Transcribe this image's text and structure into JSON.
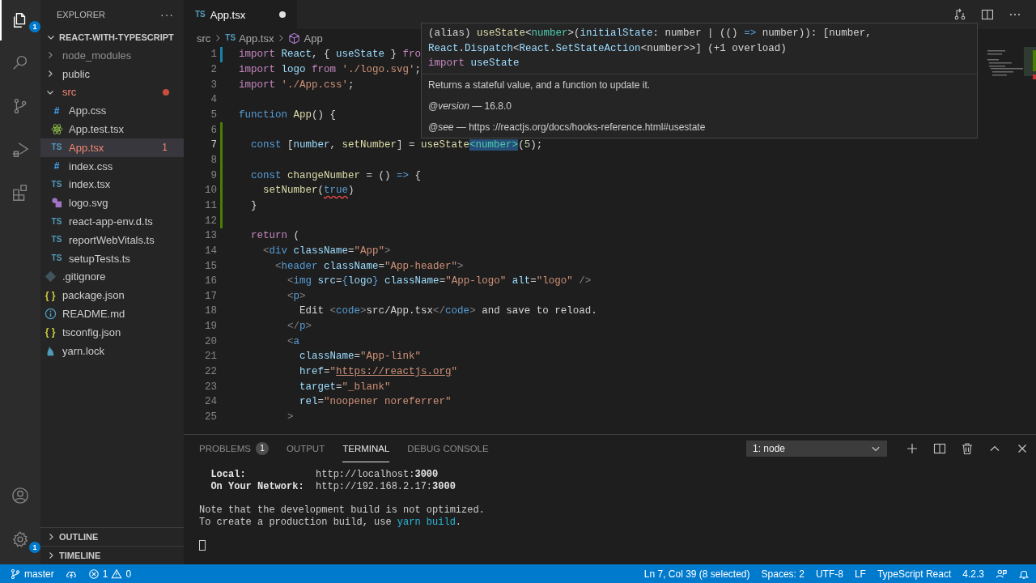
{
  "activity_bar": {
    "items": [
      {
        "kind": "explorer",
        "selected": true,
        "badge": "1"
      },
      {
        "kind": "search",
        "selected": false
      },
      {
        "kind": "source-control",
        "selected": false
      },
      {
        "kind": "run-debug",
        "selected": false
      },
      {
        "kind": "extensions",
        "selected": false
      }
    ],
    "bottom_items": [
      {
        "kind": "account"
      },
      {
        "kind": "settings",
        "badge": "1"
      }
    ]
  },
  "sidebar": {
    "title": "EXPLORER",
    "more": "···",
    "root": {
      "label": "REACT-WITH-TYPESCRIPT",
      "expanded": true,
      "children": [
        {
          "label": "node_modules",
          "kind": "folder",
          "expanded": false,
          "selected": false,
          "error": false,
          "ignored": true
        },
        {
          "label": "public",
          "kind": "folder",
          "expanded": false,
          "selected": false,
          "error": false,
          "ignored": false
        },
        {
          "label": "src",
          "kind": "folder",
          "expanded": true,
          "selected": false,
          "error": true,
          "ignored": false,
          "children": [
            {
              "label": "App.css",
              "kind": "css",
              "glyph": "#",
              "selected": false,
              "error": false,
              "ignored": false
            },
            {
              "label": "App.test.tsx",
              "kind": "react",
              "selected": false,
              "error": false,
              "ignored": false
            },
            {
              "label": "App.tsx",
              "kind": "ts",
              "glyph": "TS",
              "selected": true,
              "error": true,
              "ignored": false,
              "problems": "1"
            },
            {
              "label": "index.css",
              "kind": "css",
              "glyph": "#",
              "selected": false,
              "error": false,
              "ignored": false
            },
            {
              "label": "index.tsx",
              "kind": "ts",
              "glyph": "TS",
              "selected": false,
              "error": false,
              "ignored": false
            },
            {
              "label": "logo.svg",
              "kind": "image",
              "selected": false,
              "error": false,
              "ignored": false
            },
            {
              "label": "react-app-env.d.ts",
              "kind": "ts",
              "glyph": "TS",
              "selected": false,
              "error": false,
              "ignored": false
            },
            {
              "label": "reportWebVitals.ts",
              "kind": "ts",
              "glyph": "TS",
              "selected": false,
              "error": false,
              "ignored": false
            },
            {
              "label": "setupTests.ts",
              "kind": "ts",
              "glyph": "TS",
              "selected": false,
              "error": false,
              "ignored": false
            }
          ]
        },
        {
          "label": ".gitignore",
          "kind": "git",
          "selected": false,
          "error": false,
          "ignored": false
        },
        {
          "label": "package.json",
          "kind": "json",
          "glyph": "{ }",
          "selected": false,
          "error": false,
          "ignored": false
        },
        {
          "label": "README.md",
          "kind": "info",
          "selected": false,
          "error": false,
          "ignored": false
        },
        {
          "label": "tsconfig.json",
          "kind": "json",
          "glyph": "{ }",
          "selected": false,
          "error": false,
          "ignored": false
        },
        {
          "label": "yarn.lock",
          "kind": "yarn",
          "selected": false,
          "error": false,
          "ignored": false
        }
      ]
    },
    "sections": [
      {
        "label": "OUTLINE",
        "expanded": false
      },
      {
        "label": "TIMELINE",
        "expanded": false
      }
    ]
  },
  "editor": {
    "tabs": [
      {
        "label": "App.tsx",
        "glyph": "TS",
        "selected": true,
        "modified": true
      }
    ],
    "breadcrumb": [
      {
        "label": "src",
        "kind": "folder"
      },
      {
        "label": "App.tsx",
        "kind": "file",
        "glyph": "TS"
      },
      {
        "label": "App",
        "kind": "symbol"
      }
    ],
    "lines": [
      {
        "n": "1",
        "modified": true,
        "added": false,
        "tokens": [
          {
            "text": "import",
            "kind": "kw"
          },
          {
            "text": " React",
            "kind": "var"
          },
          {
            "text": ", { ",
            "kind": "p"
          },
          {
            "text": "useState",
            "kind": "var"
          },
          {
            "text": " } ",
            "kind": "p"
          },
          {
            "text": "fro",
            "kind": "kw"
          }
        ]
      },
      {
        "n": "2",
        "modified": false,
        "added": false,
        "tokens": [
          {
            "text": "import",
            "kind": "kw"
          },
          {
            "text": " logo",
            "kind": "var"
          },
          {
            "text": " from",
            "kind": "kw"
          },
          {
            "text": " './logo.svg'",
            "kind": "str"
          },
          {
            "text": ";",
            "kind": "p"
          }
        ]
      },
      {
        "n": "3",
        "modified": false,
        "added": false,
        "tokens": [
          {
            "text": "import",
            "kind": "kw"
          },
          {
            "text": " './App.css'",
            "kind": "str"
          },
          {
            "text": ";",
            "kind": "p"
          }
        ]
      },
      {
        "n": "4",
        "modified": false,
        "added": false
      },
      {
        "n": "5",
        "modified": false,
        "added": false,
        "tokens": [
          {
            "text": "function",
            "kind": "kwb"
          },
          {
            "text": " App",
            "kind": "fn"
          },
          {
            "text": "() {",
            "kind": "p"
          }
        ]
      },
      {
        "n": "6",
        "modified": false,
        "added": true
      },
      {
        "n": "7",
        "modified": false,
        "added": true,
        "tokens": [
          {
            "text": "  const",
            "kind": "kwb"
          },
          {
            "text": " [",
            "kind": "p"
          },
          {
            "text": "number",
            "kind": "var"
          },
          {
            "text": ", ",
            "kind": "p"
          },
          {
            "text": "setNumber",
            "kind": "fn"
          },
          {
            "text": "] = ",
            "kind": "p"
          },
          {
            "text": "useState",
            "kind": "fn"
          },
          {
            "text": "<number>",
            "kind": "sel"
          },
          {
            "text": "(",
            "kind": "p"
          },
          {
            "text": "5",
            "kind": "num"
          },
          {
            "text": ");",
            "kind": "p"
          }
        ]
      },
      {
        "n": "8",
        "modified": false,
        "added": true
      },
      {
        "n": "9",
        "modified": false,
        "added": true,
        "tokens": [
          {
            "text": "  const",
            "kind": "kwb"
          },
          {
            "text": " changeNumber",
            "kind": "fn"
          },
          {
            "text": " = () ",
            "kind": "p"
          },
          {
            "text": "=>",
            "kind": "kwb"
          },
          {
            "text": " {",
            "kind": "p"
          }
        ]
      },
      {
        "n": "10",
        "modified": false,
        "added": true,
        "tokens": [
          {
            "text": "    setNumber",
            "kind": "fn"
          },
          {
            "text": "(",
            "kind": "p"
          },
          {
            "text": "true",
            "kind": "err"
          },
          {
            "text": ")",
            "kind": "p"
          }
        ]
      },
      {
        "n": "11",
        "modified": false,
        "added": true,
        "tokens": [
          {
            "text": "  }",
            "kind": "p"
          }
        ]
      },
      {
        "n": "12",
        "modified": false,
        "added": true
      },
      {
        "n": "13",
        "modified": false,
        "added": false,
        "tokens": [
          {
            "text": "  return",
            "kind": "kw"
          },
          {
            "text": " (",
            "kind": "p"
          }
        ]
      },
      {
        "n": "14",
        "modified": false,
        "added": false,
        "tokens": [
          {
            "text": "    <",
            "kind": "tagp"
          },
          {
            "text": "div",
            "kind": "tag"
          },
          {
            "text": " className",
            "kind": "attr"
          },
          {
            "text": "=",
            "kind": "p"
          },
          {
            "text": "\"App\"",
            "kind": "str"
          },
          {
            "text": ">",
            "kind": "tagp"
          }
        ]
      },
      {
        "n": "15",
        "modified": false,
        "added": false,
        "tokens": [
          {
            "text": "      <",
            "kind": "tagp"
          },
          {
            "text": "header",
            "kind": "tag"
          },
          {
            "text": " className",
            "kind": "attr"
          },
          {
            "text": "=",
            "kind": "p"
          },
          {
            "text": "\"App-header\"",
            "kind": "str"
          },
          {
            "text": ">",
            "kind": "tagp"
          }
        ]
      },
      {
        "n": "16",
        "modified": false,
        "added": false,
        "tokens": [
          {
            "text": "        <",
            "kind": "tagp"
          },
          {
            "text": "img",
            "kind": "tag"
          },
          {
            "text": " src",
            "kind": "attr"
          },
          {
            "text": "=",
            "kind": "p"
          },
          {
            "text": "{",
            "kind": "kwb"
          },
          {
            "text": "logo",
            "kind": "var"
          },
          {
            "text": "}",
            "kind": "kwb"
          },
          {
            "text": " className",
            "kind": "attr"
          },
          {
            "text": "=",
            "kind": "p"
          },
          {
            "text": "\"App-logo\"",
            "kind": "str"
          },
          {
            "text": " alt",
            "kind": "attr"
          },
          {
            "text": "=",
            "kind": "p"
          },
          {
            "text": "\"logo\"",
            "kind": "str"
          },
          {
            "text": " />",
            "kind": "tagp"
          }
        ]
      },
      {
        "n": "17",
        "modified": false,
        "added": false,
        "tokens": [
          {
            "text": "        <",
            "kind": "tagp"
          },
          {
            "text": "p",
            "kind": "tag"
          },
          {
            "text": ">",
            "kind": "tagp"
          }
        ]
      },
      {
        "n": "18",
        "modified": false,
        "added": false,
        "tokens": [
          {
            "text": "          Edit ",
            "kind": "p"
          },
          {
            "text": "<",
            "kind": "tagp"
          },
          {
            "text": "code",
            "kind": "tag"
          },
          {
            "text": ">",
            "kind": "tagp"
          },
          {
            "text": "src/App.tsx",
            "kind": "p"
          },
          {
            "text": "</",
            "kind": "tagp"
          },
          {
            "text": "code",
            "kind": "tag"
          },
          {
            "text": ">",
            "kind": "tagp"
          },
          {
            "text": " and save to reload.",
            "kind": "p"
          }
        ]
      },
      {
        "n": "19",
        "modified": false,
        "added": false,
        "tokens": [
          {
            "text": "        </",
            "kind": "tagp"
          },
          {
            "text": "p",
            "kind": "tag"
          },
          {
            "text": ">",
            "kind": "tagp"
          }
        ]
      },
      {
        "n": "20",
        "modified": false,
        "added": false,
        "tokens": [
          {
            "text": "        <",
            "kind": "tagp"
          },
          {
            "text": "a",
            "kind": "tag"
          }
        ]
      },
      {
        "n": "21",
        "modified": false,
        "added": false,
        "tokens": [
          {
            "text": "          className",
            "kind": "attr"
          },
          {
            "text": "=",
            "kind": "p"
          },
          {
            "text": "\"App-link\"",
            "kind": "str"
          }
        ]
      },
      {
        "n": "22",
        "modified": false,
        "added": false,
        "tokens": [
          {
            "text": "          href",
            "kind": "attr"
          },
          {
            "text": "=",
            "kind": "p"
          },
          {
            "text": "\"",
            "kind": "str"
          },
          {
            "text": "https://reactjs.org",
            "kind": "link"
          },
          {
            "text": "\"",
            "kind": "str"
          }
        ]
      },
      {
        "n": "23",
        "modified": false,
        "added": false,
        "tokens": [
          {
            "text": "          target",
            "kind": "attr"
          },
          {
            "text": "=",
            "kind": "p"
          },
          {
            "text": "\"_blank\"",
            "kind": "str"
          }
        ]
      },
      {
        "n": "24",
        "modified": false,
        "added": false,
        "tokens": [
          {
            "text": "          rel",
            "kind": "attr"
          },
          {
            "text": "=",
            "kind": "p"
          },
          {
            "text": "\"noopener noreferrer\"",
            "kind": "str"
          }
        ]
      },
      {
        "n": "25",
        "modified": false,
        "added": false,
        "tokens": [
          {
            "text": "        >",
            "kind": "tagp"
          }
        ]
      }
    ],
    "hover": {
      "signature": [
        [
          {
            "text": "(alias) ",
            "kind": "p"
          },
          {
            "text": "useState",
            "kind": "fn"
          },
          {
            "text": "<",
            "kind": "p"
          },
          {
            "text": "number",
            "kind": "type"
          },
          {
            "text": ">(",
            "kind": "p"
          },
          {
            "text": "initialState",
            "kind": "var"
          },
          {
            "text": ": number | (() ",
            "kind": "p"
          },
          {
            "text": "=>",
            "kind": "kwb"
          },
          {
            "text": " number)): [number,",
            "kind": "p"
          }
        ],
        [
          {
            "text": "React",
            "kind": "var"
          },
          {
            "text": ".",
            "kind": "p"
          },
          {
            "text": "Dispatch",
            "kind": "var"
          },
          {
            "text": "<",
            "kind": "p"
          },
          {
            "text": "React",
            "kind": "var"
          },
          {
            "text": ".",
            "kind": "p"
          },
          {
            "text": "SetStateAction",
            "kind": "var"
          },
          {
            "text": "<number>>] (+1 overload)",
            "kind": "p"
          }
        ],
        [
          {
            "text": "import",
            "kind": "kw"
          },
          {
            "text": " useState",
            "kind": "var"
          }
        ]
      ],
      "description": "Returns a stateful value, and a function to update it.",
      "tags": [
        "*@version* — 16.8.0",
        "*@see* — https ://reactjs.org/docs/hooks-reference.html#usestate"
      ]
    }
  },
  "panel": {
    "tabs": [
      {
        "label": "PROBLEMS",
        "badge": "1",
        "selected": false
      },
      {
        "label": "OUTPUT",
        "selected": false
      },
      {
        "label": "TERMINAL",
        "selected": true
      },
      {
        "label": "DEBUG CONSOLE",
        "selected": false
      }
    ],
    "terminal_select": {
      "value": "1: node"
    },
    "terminal": [
      {
        "kind": "text",
        "segments": [
          {
            "text": "  Local:",
            "kind": "label"
          },
          {
            "text": "            http://localhost:",
            "kind": "text"
          },
          {
            "text": "3000",
            "kind": "label"
          }
        ]
      },
      {
        "kind": "text",
        "segments": [
          {
            "text": "  On Your Network:",
            "kind": "label"
          },
          {
            "text": "  http://192.168.2.17:",
            "kind": "text"
          },
          {
            "text": "3000",
            "kind": "label"
          }
        ]
      },
      {
        "kind": "blank"
      },
      {
        "kind": "text",
        "segments": [
          {
            "text": "Note that the development build is not optimized.",
            "kind": "text"
          }
        ]
      },
      {
        "kind": "text",
        "segments": [
          {
            "text": "To create a production build, use ",
            "kind": "text"
          },
          {
            "text": "yarn build",
            "kind": "command"
          },
          {
            "text": ".",
            "kind": "text"
          }
        ]
      },
      {
        "kind": "blank"
      },
      {
        "kind": "cursor"
      }
    ]
  },
  "status_bar": {
    "branch": "master",
    "errors": "1",
    "warnings": "0",
    "items": [
      "Ln 7, Col 39 (8 selected)",
      "Spaces: 2",
      "UTF-8",
      "LF",
      "TypeScript React",
      "4.2.3"
    ]
  }
}
